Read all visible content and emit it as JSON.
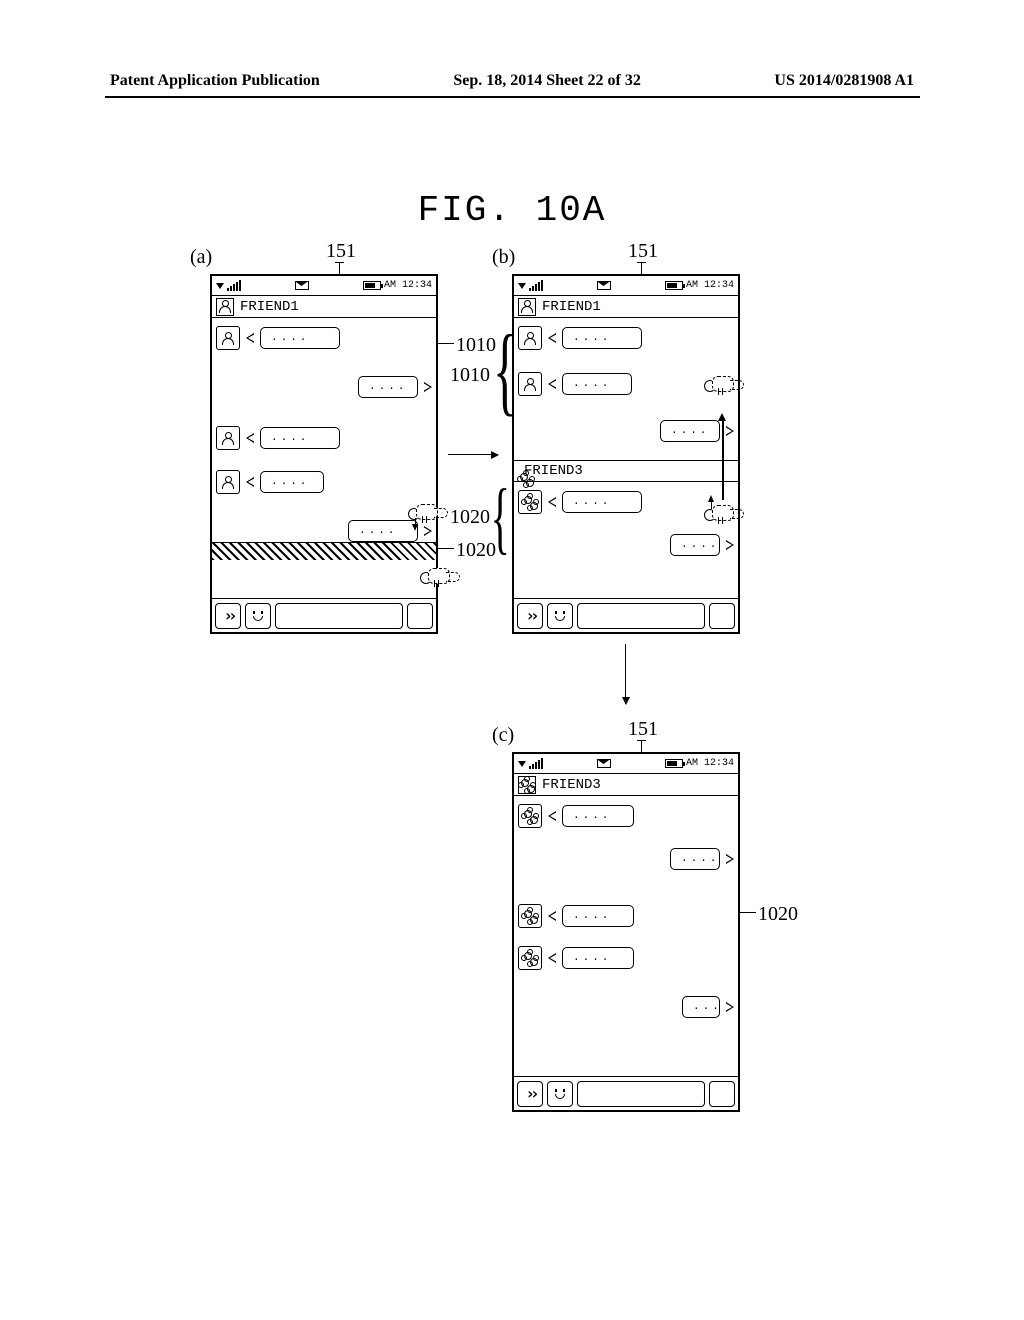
{
  "header": {
    "left": "Patent Application Publication",
    "mid": "Sep. 18, 2014  Sheet 22 of 32",
    "right": "US 2014/0281908 A1"
  },
  "figure_title": "FIG. 10A",
  "panel_labels": {
    "a": "(a)",
    "b": "(b)",
    "c": "(c)"
  },
  "ref_labels": {
    "display_a": "151",
    "display_b": "151",
    "display_c": "151",
    "region_1010_a": "1010",
    "region_1010_b": "1010",
    "region_1020_a": "1020",
    "region_1020_c": "1020"
  },
  "statusbar": {
    "time": "AM 12:34"
  },
  "friends": {
    "friend1": "FRIEND1",
    "friend3": "FRIEND3"
  },
  "bubble_text": "....",
  "bubble_text_short": "..."
}
